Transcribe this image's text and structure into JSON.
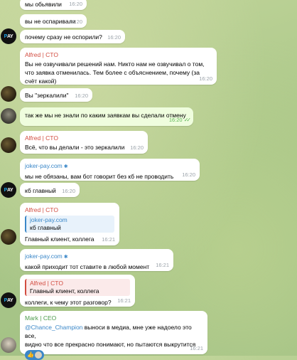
{
  "messages": [
    {
      "id": "m1",
      "text": "мы обьявили",
      "time": "16:20"
    },
    {
      "id": "m2",
      "text": "вы не оспаривали",
      "time": "16:20"
    },
    {
      "id": "m3",
      "text": "почему сразу не оспорили?",
      "time": "16:20"
    },
    {
      "id": "m4",
      "sender": "Alfred | CTO",
      "text": "Вы не озвучивали решений нам. Никто нам не озвучивал о том,\nчто заявка отменилась. Тем более с объяснением, почему (за\nсчёт какой)",
      "time": "16:20"
    },
    {
      "id": "m5",
      "text": "Вы \"зеркалили\"",
      "time": "16:20"
    },
    {
      "id": "m6",
      "text": "так же мы не знали по каким заявкам вы сделали отмену",
      "time": "16:20"
    },
    {
      "id": "m7",
      "sender": "Alfred | CTO",
      "text": "Всё, что вы делали - это зеркалили",
      "time": "16:20"
    },
    {
      "id": "m8",
      "sender": "joker-pay.com",
      "text": "мы не обязаны, вам бот говорит без кб не проводить",
      "time": "16:20"
    },
    {
      "id": "m9",
      "text": "кб главный",
      "time": "16:20"
    },
    {
      "id": "m10",
      "sender": "Alfred | CTO",
      "quote_sender": "joker-pay.com",
      "quote_text": "кб главный",
      "text": "Главный клиент, коллега",
      "time": "16:21"
    },
    {
      "id": "m11",
      "sender": "joker-pay.com",
      "text": "какой приходит тот ставите в любой момент",
      "time": "16:21"
    },
    {
      "id": "m12",
      "quote_sender": "Alfred | CTO",
      "quote_text": "Главный клиент, коллега",
      "text": "коллеги, к чему этот разговор?",
      "time": "16:21"
    },
    {
      "id": "m13",
      "sender": "Mark | CEO",
      "mention": "@Chance_Champion",
      "text": " выноси в медиа, мне уже надоело это все,\nвидно что все прекрасно понимают, но пытаются выкрутится",
      "time": "16:21",
      "reaction": "👍"
    }
  ],
  "avatars": {
    "joker_label_p": "P",
    "joker_label_ay": "AY"
  },
  "colors": {
    "red_sender": "#d24c40",
    "blue_sender": "#3a87c8",
    "green_sender": "#4c9b4b",
    "outgoing_bubble": "#effdde"
  }
}
